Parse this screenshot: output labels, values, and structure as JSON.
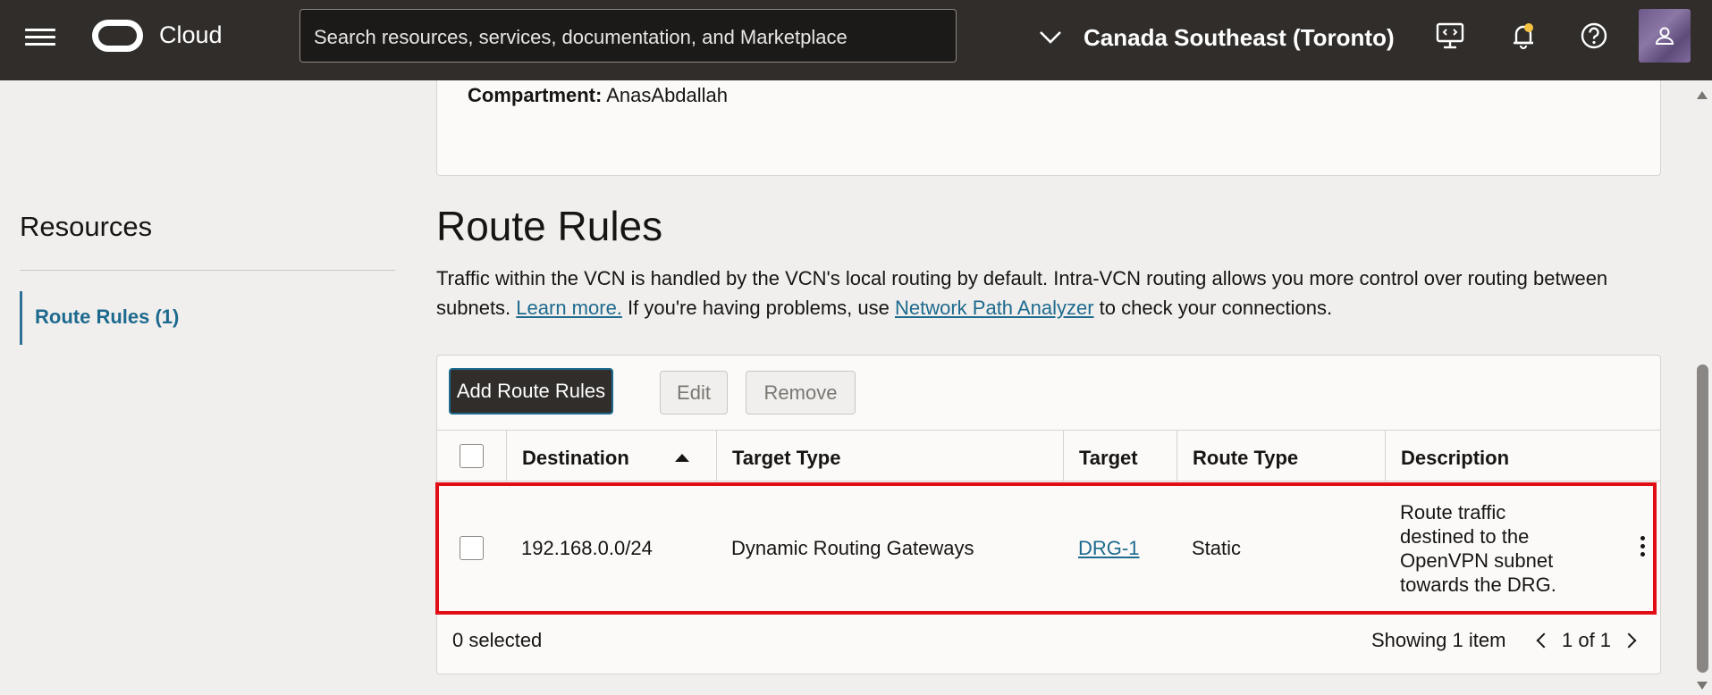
{
  "topbar": {
    "brand": "Cloud",
    "search_placeholder": "Search resources, services, documentation, and Marketplace",
    "region": "Canada Southeast (Toronto)"
  },
  "info": {
    "compartment_label": "Compartment:",
    "compartment_value": "AnasAbdallah"
  },
  "sidebar": {
    "title": "Resources",
    "items": [
      {
        "label": "Route Rules (1)"
      }
    ]
  },
  "section": {
    "title": "Route Rules",
    "desc_part1": "Traffic within the VCN is handled by the VCN's local routing by default. Intra-VCN routing allows you more control over routing between subnets.",
    "learn_more": "Learn more.",
    "desc_part2": "If you're having problems, use",
    "npa_link": "Network Path Analyzer",
    "desc_part3": "to check your connections."
  },
  "toolbar": {
    "add_label": "Add Route Rules",
    "edit_label": "Edit",
    "remove_label": "Remove"
  },
  "table": {
    "columns": [
      "Destination",
      "Target Type",
      "Target",
      "Route Type",
      "Description"
    ],
    "rows": [
      {
        "destination": "192.168.0.0/24",
        "target_type": "Dynamic Routing Gateways",
        "target": "DRG-1",
        "route_type": "Static",
        "description": "Route traffic destined to the OpenVPN subnet towards the DRG."
      }
    ],
    "selected": "0 selected",
    "showing": "Showing 1 item",
    "page": "1 of 1"
  },
  "colors": {
    "topbar": "#312d2a",
    "link": "#1d6a8e",
    "highlight": "#e00d16"
  }
}
